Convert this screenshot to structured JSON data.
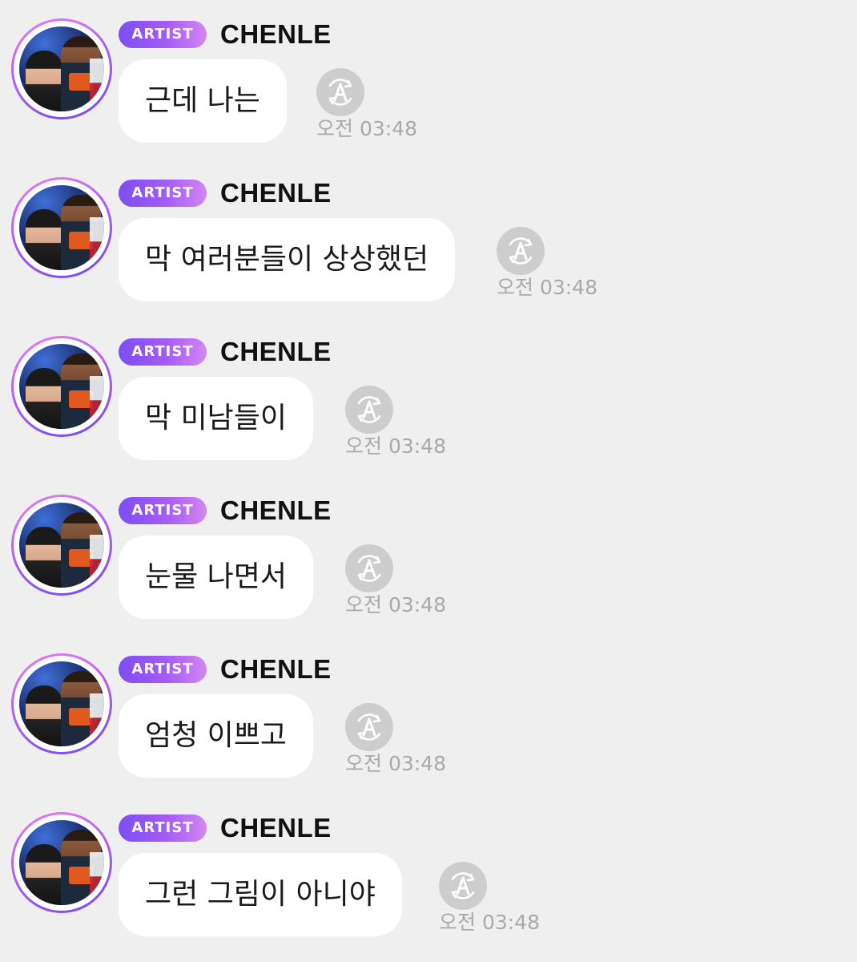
{
  "messages": [
    {
      "badge": "ARTIST",
      "sender": "CHENLE",
      "text": "근데 나는",
      "time": "오전 03:48",
      "avatar_icon": "artist-avatar",
      "translate_icon": "translate-icon"
    },
    {
      "badge": "ARTIST",
      "sender": "CHENLE",
      "text": "막 여러분들이 상상했던",
      "time": "오전 03:48",
      "avatar_icon": "artist-avatar",
      "translate_icon": "translate-icon"
    },
    {
      "badge": "ARTIST",
      "sender": "CHENLE",
      "text": "막 미남들이",
      "time": "오전 03:48",
      "avatar_icon": "artist-avatar",
      "translate_icon": "translate-icon"
    },
    {
      "badge": "ARTIST",
      "sender": "CHENLE",
      "text": "눈물 나면서",
      "time": "오전 03:48",
      "avatar_icon": "artist-avatar",
      "translate_icon": "translate-icon"
    },
    {
      "badge": "ARTIST",
      "sender": "CHENLE",
      "text": "엄청 이쁘고",
      "time": "오전 03:48",
      "avatar_icon": "artist-avatar",
      "translate_icon": "translate-icon"
    },
    {
      "badge": "ARTIST",
      "sender": "CHENLE",
      "text": "그런 그림이 아니야",
      "time": "오전 03:48",
      "avatar_icon": "artist-avatar",
      "translate_icon": "translate-icon"
    }
  ],
  "colors": {
    "background": "#efefef",
    "bubble": "#ffffff",
    "badge_start": "#7c4df2",
    "badge_end": "#d585f2",
    "avatar_ring": "#b45cf5",
    "translate_button": "#cdcdcd",
    "timestamp": "#a9a9a9"
  }
}
